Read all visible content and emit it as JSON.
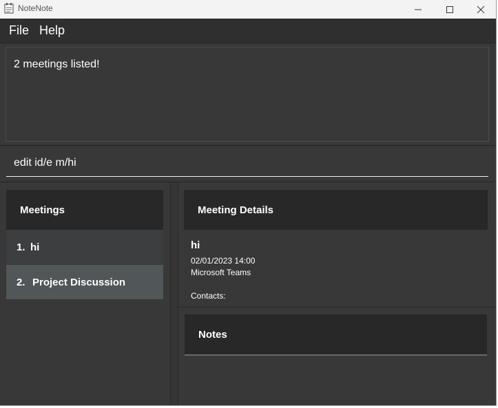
{
  "window": {
    "title": "NoteNote"
  },
  "menu": {
    "file": "File",
    "help": "Help"
  },
  "result": {
    "message": "2 meetings listed!"
  },
  "command": {
    "value": "edit id/e m/hi"
  },
  "meetings": {
    "header": "Meetings",
    "items": [
      {
        "index": "1.",
        "title": "hi"
      },
      {
        "index": "2.",
        "title": "Project Discussion"
      }
    ]
  },
  "details": {
    "header": "Meeting Details",
    "name": "hi",
    "datetime": "02/01/2023 14:00",
    "location": "Microsoft Teams",
    "contacts_label": "Contacts:"
  },
  "notes": {
    "header": "Notes"
  },
  "icons": {
    "app": "app-icon",
    "minimize": "minimize-icon",
    "maximize": "maximize-icon",
    "close": "close-icon"
  }
}
